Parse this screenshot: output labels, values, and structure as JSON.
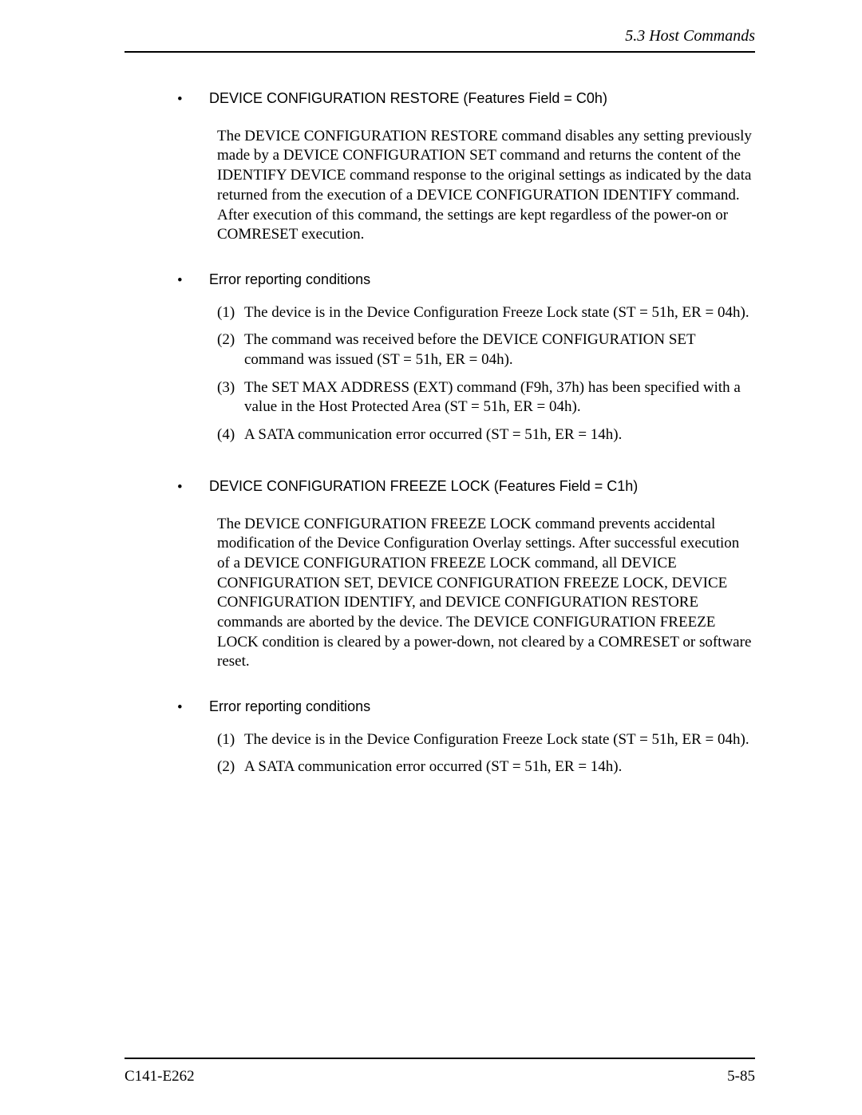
{
  "header": {
    "section": "5.3  Host Commands"
  },
  "items": [
    {
      "title": "DEVICE CONFIGURATION RESTORE (Features Field = C0h)",
      "paragraph": "The DEVICE CONFIGURATION RESTORE command disables any setting previously made by a DEVICE CONFIGURATION SET command and returns the content of the IDENTIFY DEVICE command response to the original settings as indicated by the data returned from the execution of a DEVICE CONFIGURATION IDENTIFY command.  After execution of this command, the settings are kept regardless of the power-on or COMRESET execution."
    },
    {
      "title": "Error reporting conditions",
      "ordered": [
        "The device is in the Device Configuration Freeze Lock state (ST = 51h, ER = 04h).",
        "The command was received before the DEVICE CONFIGURATION SET command was issued (ST = 51h, ER = 04h).",
        "The SET MAX ADDRESS (EXT) command (F9h, 37h) has been specified with a value in the Host Protected Area (ST = 51h, ER = 04h).",
        "A SATA communication error occurred (ST = 51h, ER = 14h)."
      ]
    },
    {
      "title": "DEVICE CONFIGURATION FREEZE LOCK (Features Field = C1h)",
      "paragraph": "The DEVICE CONFIGURATION FREEZE LOCK command prevents accidental modification of the Device Configuration Overlay settings.  After successful execution of a DEVICE CONFIGURATION FREEZE LOCK command, all DEVICE CONFIGURATION SET, DEVICE CONFIGURATION FREEZE LOCK, DEVICE CONFIGURATION IDENTIFY, and DEVICE CONFIGURATION RESTORE commands are aborted by the device.  The DEVICE CONFIGURATION FREEZE LOCK condition is cleared by a power-down, not cleared by a COMRESET or software reset."
    },
    {
      "title": "Error reporting conditions",
      "ordered": [
        "The device is in the Device Configuration Freeze Lock state (ST = 51h, ER = 04h).",
        "A SATA communication error occurred (ST = 51h, ER = 14h)."
      ]
    }
  ],
  "footer": {
    "left": "C141-E262",
    "right": "5-85"
  }
}
